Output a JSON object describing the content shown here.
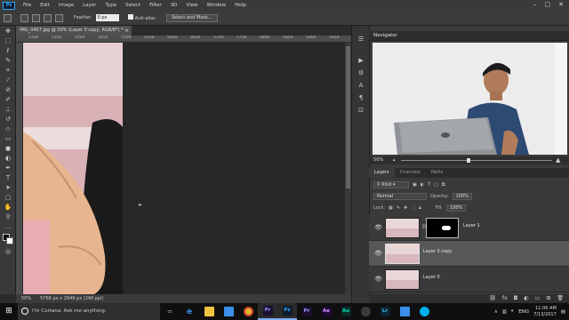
{
  "menubar": {
    "logo": "Ps",
    "items": [
      "File",
      "Edit",
      "Image",
      "Layer",
      "Type",
      "Select",
      "Filter",
      "3D",
      "View",
      "Window",
      "Help"
    ],
    "window_controls": [
      "–",
      "▢",
      "✕"
    ]
  },
  "options": {
    "feather_label": "Feather:",
    "feather_value": "0 px",
    "antialias_label": "Anti-alias",
    "select_mask_button": "Select and Mask..."
  },
  "document": {
    "tab_title": "IMG_0457.jpg @ 50% (Layer 0 copy, RGB/8*) *",
    "close": "×",
    "ruler_ticks": [
      "5300",
      "5350",
      "5400",
      "5450",
      "5500",
      "5550",
      "5600",
      "5650",
      "5700",
      "5750",
      "5800",
      "5850",
      "5900",
      "5950"
    ]
  },
  "statusbar": {
    "zoom": "50%",
    "doc_size": "5766 px x 2949 px (240 ppi)"
  },
  "navigator": {
    "title": "Navigator",
    "zoom": "50%"
  },
  "layers_panel": {
    "tabs": [
      "Layers",
      "Channels",
      "Paths"
    ],
    "active_tab": "Layers",
    "kind_label": "Kind",
    "blend_mode": "Normal",
    "opacity_label": "Opacity:",
    "opacity_value": "100%",
    "lock_label": "Lock:",
    "fill_label": "Fill:",
    "fill_value": "100%",
    "layers": [
      {
        "name": "Layer 1",
        "has_mask": true,
        "selected": false
      },
      {
        "name": "Layer 0 copy",
        "has_mask": false,
        "selected": true
      },
      {
        "name": "Layer 0",
        "has_mask": false,
        "selected": false
      }
    ]
  },
  "taskbar": {
    "cortana_text": "I'm Cortana. Ask me anything.",
    "apps": [
      "Pr",
      "Ps",
      "Pr",
      "Ae",
      "Au",
      "Lr"
    ],
    "time": "11:06 AM",
    "date": "7/13/2017"
  },
  "colors": {
    "photoshop_blue": "#31a8ff",
    "premiere_purple": "#9999ff",
    "after_effects_purple": "#d291ff",
    "audition_green": "#00e4bb",
    "lightroom_blue": "#31c5f0"
  }
}
